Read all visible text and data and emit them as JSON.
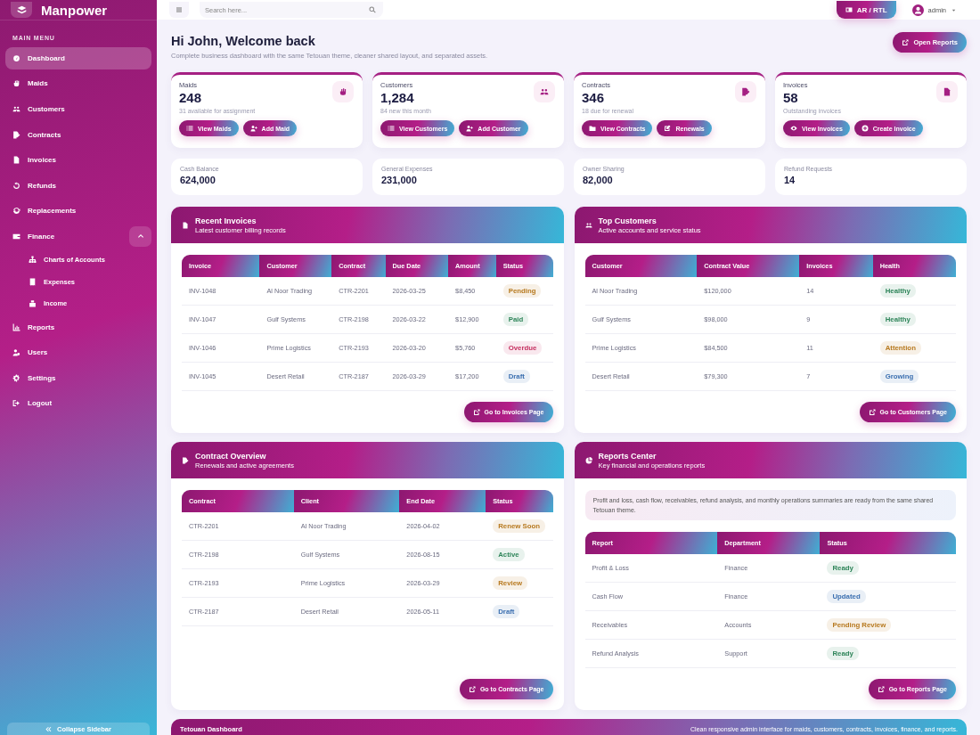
{
  "sidebar": {
    "brand": "Manpower",
    "section_label": "MAIN MENU",
    "items": [
      {
        "label": "Dashboard",
        "selected": true
      },
      {
        "label": "Maids",
        "selected": false
      },
      {
        "label": "Customers",
        "selected": false
      },
      {
        "label": "Contracts",
        "selected": false
      },
      {
        "label": "Invoices",
        "selected": false
      },
      {
        "label": "Refunds",
        "selected": false
      },
      {
        "label": "Replacements",
        "selected": false
      },
      {
        "label": "Finance",
        "selected": false,
        "expanded": true,
        "children": [
          {
            "label": "Charts of Accounts",
            "selected": false
          },
          {
            "label": "Expenses",
            "selected": false
          },
          {
            "label": "Income",
            "selected": false
          }
        ]
      },
      {
        "label": "Reports",
        "selected": false
      },
      {
        "label": "Users",
        "selected": false
      },
      {
        "label": "Settings",
        "selected": false
      },
      {
        "label": "Logout",
        "selected": false
      }
    ],
    "collapse_button": "Collapse Sidebar"
  },
  "topbar": {
    "search": {
      "placeholder": "Search here..."
    },
    "language_button": "AR / RTL",
    "user": "admin"
  },
  "header": {
    "title": "Hi John, Welcome back",
    "subtitle": "Complete business dashboard with the same Tetouan theme, cleaner shared layout, and separated assets.",
    "action": "Open Reports"
  },
  "stat_cards": [
    {
      "label": "Maids",
      "value": "248",
      "note": "31 available for assignment",
      "buttons": [
        "View Maids",
        "Add Maid"
      ]
    },
    {
      "label": "Customers",
      "value": "1,284",
      "note": "84 new this month",
      "buttons": [
        "View Customers",
        "Add Customer"
      ]
    },
    {
      "label": "Contracts",
      "value": "346",
      "note": "18 due for renewal",
      "buttons": [
        "View Contracts",
        "Renewals"
      ]
    },
    {
      "label": "Invoices",
      "value": "58",
      "note": "Outstanding invoices",
      "buttons": [
        "View Invoices",
        "Create Invoice"
      ]
    }
  ],
  "summary_cards": [
    {
      "label": "Cash Balance",
      "value": "624,000"
    },
    {
      "label": "General Expenses",
      "value": "231,000"
    },
    {
      "label": "Owner Sharing",
      "value": "82,000"
    },
    {
      "label": "Refund Requests",
      "value": "14"
    }
  ],
  "panels": [
    {
      "title": "Recent Invoices",
      "subtitle": "Latest customer billing records",
      "columns": [
        "Invoice",
        "Customer",
        "Contract",
        "Due Date",
        "Amount",
        "Status"
      ],
      "rows": [
        {
          "cells": [
            "INV-1048",
            "Al Noor Trading",
            "CTR-2201",
            "2026-03-25",
            "$8,450"
          ],
          "status": {
            "label": "Pending",
            "color": "#b7791f"
          }
        },
        {
          "cells": [
            "INV-1047",
            "Gulf Systems",
            "CTR-2198",
            "2026-03-22",
            "$12,900"
          ],
          "status": {
            "label": "Paid",
            "color": "#2f855a"
          }
        },
        {
          "cells": [
            "INV-1046",
            "Prime Logistics",
            "CTR-2193",
            "2026-03-20",
            "$5,760"
          ],
          "status": {
            "label": "Overdue",
            "color": "#c53060"
          }
        },
        {
          "cells": [
            "INV-1045",
            "Desert Retail",
            "CTR-2187",
            "2026-03-29",
            "$17,200"
          ],
          "status": {
            "label": "Draft",
            "color": "#3b6fb0"
          }
        }
      ],
      "button": "Go to Invoices Page"
    },
    {
      "title": "Top Customers",
      "subtitle": "Active accounts and service status",
      "columns": [
        "Customer",
        "Contract Value",
        "Invoices",
        "Health"
      ],
      "rows": [
        {
          "cells": [
            "Al Noor Trading",
            "$120,000",
            "14"
          ],
          "status": {
            "label": "Healthy",
            "color": "#2f855a"
          }
        },
        {
          "cells": [
            "Gulf Systems",
            "$98,000",
            "9"
          ],
          "status": {
            "label": "Healthy",
            "color": "#2f855a"
          }
        },
        {
          "cells": [
            "Prime Logistics",
            "$84,500",
            "11"
          ],
          "status": {
            "label": "Attention",
            "color": "#b7791f"
          }
        },
        {
          "cells": [
            "Desert Retail",
            "$79,300",
            "7"
          ],
          "status": {
            "label": "Growing",
            "color": "#3b6fb0"
          }
        }
      ],
      "button": "Go to Customers Page"
    },
    {
      "title": "Contract Overview",
      "subtitle": "Renewals and active agreements",
      "columns": [
        "Contract",
        "Client",
        "End Date",
        "Status"
      ],
      "rows": [
        {
          "cells": [
            "CTR-2201",
            "Al Noor Trading",
            "2026-04-02"
          ],
          "status": {
            "label": "Renew Soon",
            "color": "#b7791f"
          }
        },
        {
          "cells": [
            "CTR-2198",
            "Gulf Systems",
            "2026-08-15"
          ],
          "status": {
            "label": "Active",
            "color": "#2f855a"
          }
        },
        {
          "cells": [
            "CTR-2193",
            "Prime Logistics",
            "2026-03-29"
          ],
          "status": {
            "label": "Review",
            "color": "#b7791f"
          }
        },
        {
          "cells": [
            "CTR-2187",
            "Desert Retail",
            "2026-05-11"
          ],
          "status": {
            "label": "Draft",
            "color": "#3b6fb0"
          }
        }
      ],
      "button": "Go to Contracts Page"
    },
    {
      "title": "Reports Center",
      "subtitle": "Key financial and operations reports",
      "note": "Profit and loss, cash flow, receivables, refund analysis, and monthly operations summaries are ready from the same shared Tetouan theme.",
      "columns": [
        "Report",
        "Department",
        "Status"
      ],
      "rows": [
        {
          "cells": [
            "Profit & Loss",
            "Finance"
          ],
          "status": {
            "label": "Ready",
            "color": "#2f855a"
          }
        },
        {
          "cells": [
            "Cash Flow",
            "Finance"
          ],
          "status": {
            "label": "Updated",
            "color": "#3b6fb0"
          }
        },
        {
          "cells": [
            "Receivables",
            "Accounts"
          ],
          "status": {
            "label": "Pending Review",
            "color": "#b7791f"
          }
        },
        {
          "cells": [
            "Refund Analysis",
            "Support"
          ],
          "status": {
            "label": "Ready",
            "color": "#2f855a"
          }
        }
      ],
      "button": "Go to Reports Page"
    }
  ],
  "footer": {
    "title": "Tetouan Dashboard",
    "text": "Clean responsive admin interface for maids, customers, contracts, invoices, finance, and reports."
  }
}
